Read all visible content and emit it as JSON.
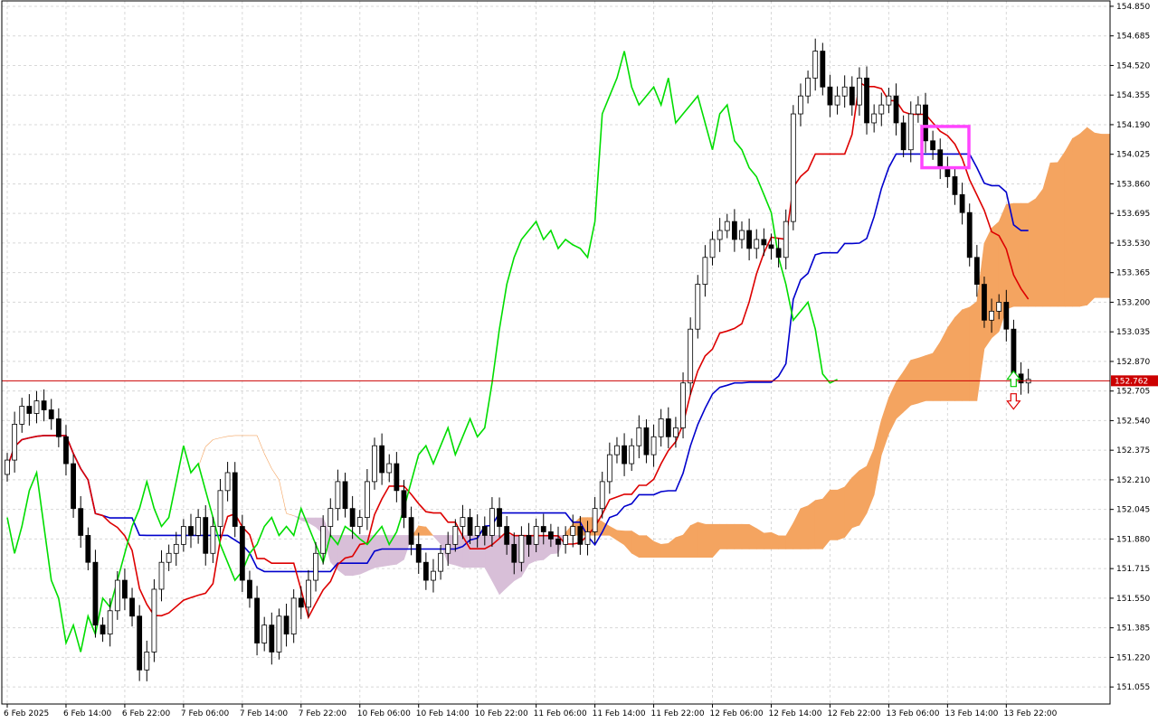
{
  "chart_data": {
    "type": "candlestick",
    "title": "",
    "xlabel": "",
    "ylabel": "",
    "ylim": [
      150.96,
      154.88
    ],
    "grid": true,
    "current_price": "152.762",
    "y_ticks": [
      "154.850",
      "154.685",
      "154.520",
      "154.355",
      "154.190",
      "154.025",
      "153.860",
      "153.695",
      "153.530",
      "153.365",
      "153.200",
      "153.035",
      "152.870",
      "152.705",
      "152.540",
      "152.375",
      "152.210",
      "152.045",
      "151.880",
      "151.715",
      "151.550",
      "151.385",
      "151.220",
      "151.055"
    ],
    "x_ticks": [
      "6 Feb 2025",
      "6 Feb 14:00",
      "6 Feb 22:00",
      "7 Feb 06:00",
      "7 Feb 14:00",
      "7 Feb 22:00",
      "10 Feb 06:00",
      "10 Feb 14:00",
      "10 Feb 22:00",
      "11 Feb 06:00",
      "11 Feb 14:00",
      "11 Feb 22:00",
      "12 Feb 06:00",
      "12 Feb 14:00",
      "12 Feb 22:00",
      "13 Feb 06:00",
      "13 Feb 14:00",
      "13 Feb 22:00"
    ],
    "x_tick_bar_index": [
      0,
      8,
      16,
      24,
      32,
      40,
      48,
      56,
      64,
      72,
      80,
      88,
      96,
      104,
      112,
      120,
      128,
      136
    ],
    "bar_count": 138,
    "cloud_shift": 26,
    "series": [
      {
        "key": "ohlc",
        "type": "candlestick",
        "close": [
          152.32,
          152.52,
          152.62,
          152.58,
          152.65,
          152.6,
          152.55,
          152.45,
          152.3,
          152.05,
          151.9,
          151.75,
          151.4,
          151.35,
          151.48,
          151.65,
          151.55,
          151.45,
          151.15,
          151.25,
          151.6,
          151.75,
          151.8,
          151.85,
          151.95,
          151.9,
          152.0,
          151.8,
          151.95,
          152.15,
          152.25,
          151.95,
          151.65,
          151.55,
          151.3,
          151.4,
          151.25,
          151.45,
          151.35,
          151.55,
          151.5,
          151.65,
          151.8,
          151.95,
          152.05,
          152.2,
          152.05,
          151.95,
          152.0,
          152.2,
          152.4,
          152.25,
          152.3,
          152.15,
          152.0,
          151.85,
          151.75,
          151.65,
          151.7,
          151.8,
          151.85,
          151.95,
          152.0,
          151.9,
          151.95,
          151.9,
          152.05,
          151.95,
          151.85,
          151.75,
          151.9,
          151.85,
          151.95,
          151.92,
          151.88,
          151.85,
          151.9,
          151.95,
          151.85,
          151.92,
          152.05,
          152.2,
          152.35,
          152.4,
          152.3,
          152.4,
          152.5,
          152.35,
          152.45,
          152.55,
          152.45,
          152.5,
          152.75,
          153.05,
          153.3,
          153.45,
          153.55,
          153.6,
          153.65,
          153.55,
          153.6,
          153.5,
          153.55,
          153.52,
          153.5,
          153.45,
          153.65,
          154.25,
          154.35,
          154.45,
          154.6,
          154.4,
          154.3,
          154.35,
          154.4,
          154.3,
          154.45,
          154.2,
          154.25,
          154.3,
          154.35,
          154.2,
          154.05,
          154.25,
          154.3,
          154.1,
          154.05,
          153.95,
          153.9,
          153.8,
          153.7,
          153.45,
          153.3,
          153.1,
          153.15,
          153.2,
          153.05,
          152.8,
          152.75,
          152.77
        ]
      },
      {
        "key": "tenkan",
        "name": "",
        "color": "#dd0000"
      },
      {
        "key": "kijun",
        "name": "",
        "color": "#0000cc"
      },
      {
        "key": "chikou",
        "name": "",
        "color": "#00dd00"
      },
      {
        "key": "cloud",
        "name": "",
        "bull_color": "#f4a460",
        "bear_color": "#d8bfd8"
      }
    ],
    "markers": {
      "highlight_box_color": "#ff44ff",
      "arrow_up_color": "#00cc00",
      "arrow_down_color": "#dd0000",
      "current_line_color": "#cc0000"
    }
  }
}
